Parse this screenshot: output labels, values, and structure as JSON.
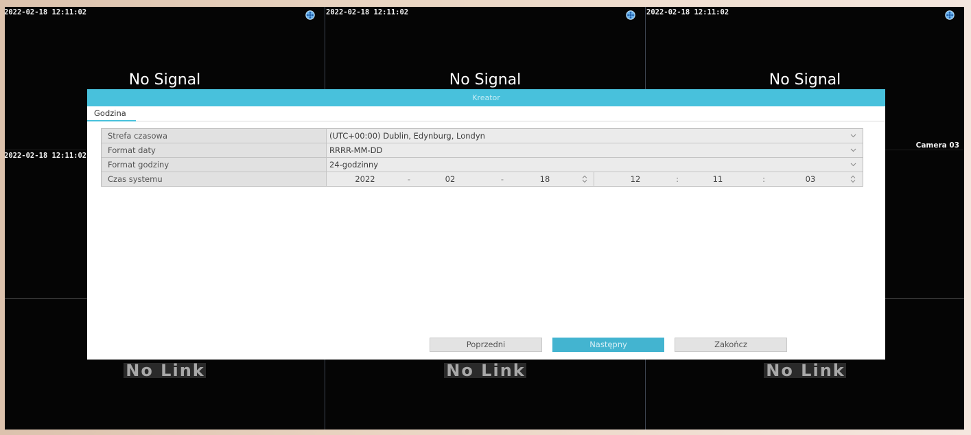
{
  "colors": {
    "accent": "#48c1dc",
    "button_primary": "#43b4d0",
    "screen_background": "#050505",
    "bezel": "#ead5c2"
  },
  "preview": {
    "tiles": [
      {
        "timestamp": "2022-02-18 12:11:02",
        "status": "No Signal",
        "icon": "camera-status-icon"
      },
      {
        "timestamp": "2022-02-18 12:11:02",
        "status": "No Signal",
        "icon": "camera-status-icon"
      },
      {
        "timestamp": "2022-02-18 12:11:02",
        "status": "No Signal",
        "icon": "camera-status-icon",
        "camera_name": "Camera 03"
      },
      {
        "timestamp": "2022-02-18 12:11:02"
      },
      {},
      {},
      {
        "status": "No Link"
      },
      {
        "status": "No Link"
      },
      {
        "status": "No Link"
      }
    ]
  },
  "wizard": {
    "title": "Kreator",
    "tabs": [
      {
        "label": "Godzina",
        "active": true
      }
    ],
    "fields": [
      {
        "label": "Strefa czasowa",
        "value": "(UTC+00:00) Dublin, Edynburg, Londyn",
        "icon": "chevron-down-icon"
      },
      {
        "label": "Format daty",
        "value": "RRRR-MM-DD",
        "icon": "chevron-down-icon"
      },
      {
        "label": "Format godziny",
        "value": "24-godzinny",
        "icon": "chevron-down-icon"
      },
      {
        "label": "Czas systemu",
        "date": {
          "year": "2022",
          "sep1": "-",
          "month": "02",
          "sep2": "-",
          "day": "18"
        },
        "time": {
          "hour": "12",
          "sep1": ":",
          "minute": "11",
          "sep2": ":",
          "second": "03"
        },
        "icon": "spinner-updown-icon"
      }
    ],
    "buttons": {
      "previous": "Poprzedni",
      "next": "Następny",
      "finish": "Zakończ"
    }
  }
}
